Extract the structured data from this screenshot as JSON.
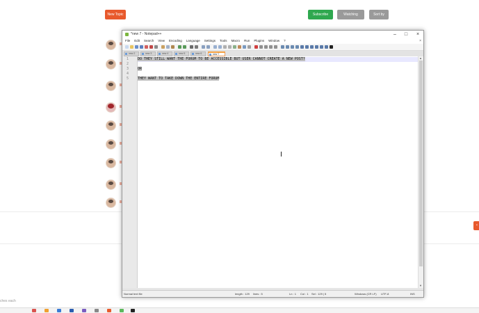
{
  "background": {
    "new_topic_label": "New Topic",
    "subscribe_label": "Subscribe",
    "watching_label": "Watching",
    "sortby_label": "Sort by",
    "search_hint": "ches each"
  },
  "notepad": {
    "title": "*new 7 - Notepad++",
    "controls": {
      "minimize": "–",
      "maximize": "□",
      "close": "×"
    },
    "menu": [
      "File",
      "Edit",
      "Search",
      "View",
      "Encoding",
      "Language",
      "Settings",
      "Tools",
      "Macro",
      "Run",
      "Plugins",
      "Window",
      "?"
    ],
    "menu_close": "×",
    "tabs": [
      "new 2",
      "new 3",
      "new 4",
      "new 5",
      "new 6",
      "new 7"
    ],
    "active_tab_index": 5,
    "line_numbers": [
      "1",
      "2",
      "3",
      "4",
      "5"
    ],
    "lines": [
      "DO THEY STILL WANT THE FORUM TO BE ACCESSIBLE BUT USER CANNOT CREATE A NEW POST?",
      "",
      "OR",
      "",
      "THEY WANT TO TAKE DOWN THE ENTIRE FORUM"
    ],
    "status": {
      "file_type": "Normal text file",
      "length": "length : 129",
      "lines": "lines : 5",
      "ln": "Ln : 1",
      "col": "Col : 1",
      "sel": "Sel : 129 | 5",
      "eol": "Windows (CR LF)",
      "encoding": "UTF-8",
      "mode": "INS"
    }
  },
  "colors": {
    "new_topic": "#e8592c",
    "subscribe": "#2fa84f",
    "neutral_button": "#9a9a9a",
    "selection": "#c0c0c0",
    "current_line": "#e8e8ff"
  }
}
